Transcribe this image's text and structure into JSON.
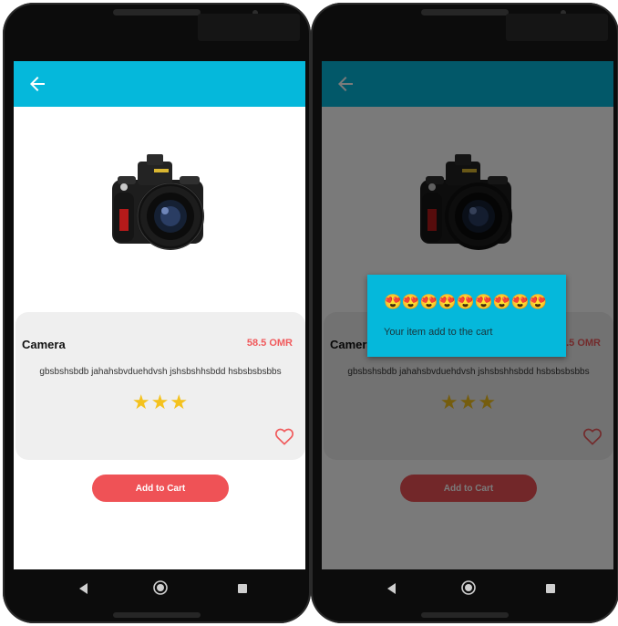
{
  "product": {
    "name": "Camera",
    "price": "58.5 OMR",
    "description": "gbsbshsbdb jahahsbvduehdvsh jshsbshhsbdd hsbsbsbsbbs",
    "rating_stars": "★★★",
    "rating_value": 3,
    "rating_max": 3
  },
  "actions": {
    "add_to_cart_label": "Add to Cart"
  },
  "dialog": {
    "emojis": "😍😍😍😍😍😍😍😍😍",
    "message": "Your item add to the cart"
  },
  "colors": {
    "appbar": "#05b8db",
    "accent": "#ef5256",
    "price": "#f05a5c",
    "star": "#f4c21e",
    "dialog": "#05b8db"
  },
  "icons": {
    "back": "arrow-left-icon",
    "favorite": "heart-outline-icon",
    "nav_back": "triangle-back-icon",
    "nav_home": "circle-home-icon",
    "nav_recents": "square-recents-icon"
  }
}
